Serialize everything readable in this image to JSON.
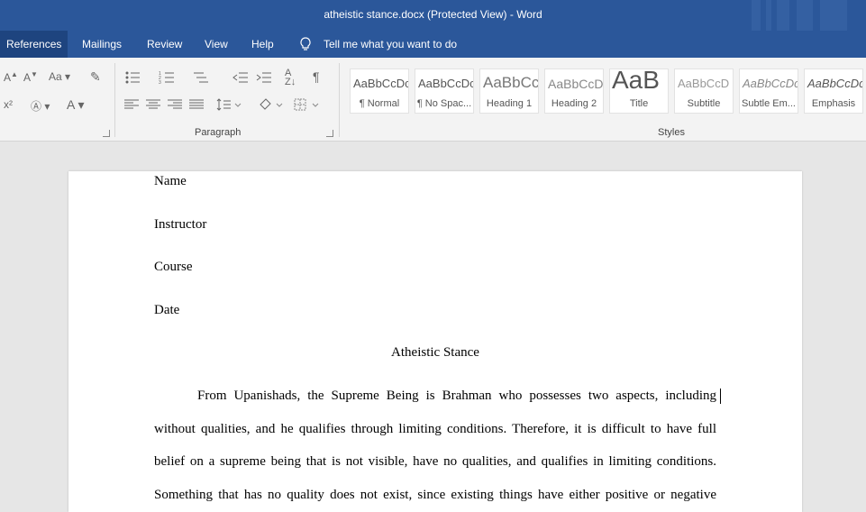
{
  "window": {
    "title": "atheistic stance.docx (Protected View)  -  Word"
  },
  "tabs": {
    "references": "References",
    "mailings": "Mailings",
    "review": "Review",
    "view": "View",
    "help": "Help"
  },
  "tell_me": "Tell me what you want to do",
  "ribbon": {
    "font": {
      "case_label": "Aa",
      "font_color_glyph": "A"
    },
    "paragraph": {
      "label": "Paragraph",
      "pilcrow": "¶"
    },
    "styles": {
      "label": "Styles",
      "items": [
        {
          "sample": "AaBbCcDc",
          "name": "¶ Normal"
        },
        {
          "sample": "AaBbCcDc",
          "name": "¶ No Spac..."
        },
        {
          "sample": "AaBbCc",
          "name": "Heading 1"
        },
        {
          "sample": "AaBbCcD",
          "name": "Heading 2"
        },
        {
          "sample": "AaB",
          "name": "Title"
        },
        {
          "sample": "AaBbCcD",
          "name": "Subtitle"
        },
        {
          "sample": "AaBbCcDc",
          "name": "Subtle Em..."
        },
        {
          "sample": "AaBbCcDc",
          "name": "Emphasis"
        }
      ]
    }
  },
  "document": {
    "header_lines": [
      "Name",
      "Instructor",
      "Course",
      "Date"
    ],
    "title": "Atheistic Stance",
    "body_lines": [
      "From Upanishads, the Supreme Being is Brahman who possesses two aspects, including",
      "without qualities, and he qualifies through limiting conditions. Therefore, it is difficult to have full",
      "belief on a supreme being that is not visible, have no qualities, and qualifies in limiting conditions.",
      "Something that has no quality does not exist, since existing things have either positive or negative"
    ]
  },
  "colors": {
    "title_bar": "#2b579a",
    "ribbon_bg": "#f3f3f3",
    "canvas_bg": "#e6e6e6"
  }
}
